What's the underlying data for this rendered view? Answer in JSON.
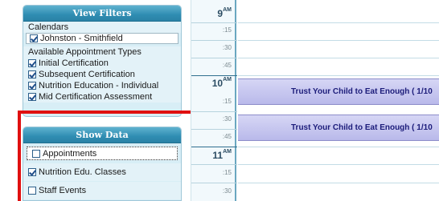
{
  "view_filters": {
    "title": "View Filters",
    "calendars_label": "Calendars",
    "calendars": [
      {
        "label": "Johnston - Smithfield",
        "checked": true
      }
    ],
    "appointment_types_label": "Available Appointment Types",
    "appointment_types": [
      {
        "label": "Initial Certification",
        "checked": true
      },
      {
        "label": "Subsequent Certification",
        "checked": true
      },
      {
        "label": "Nutrition Education - Individual",
        "checked": true
      },
      {
        "label": "Mid Certification Assessment",
        "checked": true
      }
    ]
  },
  "show_data": {
    "title": "Show Data",
    "items": [
      {
        "label": "Appointments",
        "checked": false
      },
      {
        "label": "Nutrition Edu. Classes",
        "checked": true
      },
      {
        "label": "Staff Events",
        "checked": false
      }
    ]
  },
  "time_column": {
    "hours": [
      {
        "hour": "9",
        "suffix": "AM"
      },
      {
        "hour": "10",
        "suffix": "AM"
      },
      {
        "hour": "11",
        "suffix": "AM"
      }
    ],
    "slots": [
      ":15",
      ":30",
      ":45"
    ]
  },
  "events": [
    {
      "title": "Trust Your Child to Eat Enough ( 1/10",
      "color": "#c8c8f0"
    },
    {
      "title": "Trust Your Child to Eat Enough ( 1/10",
      "color": "#c8c8f0"
    }
  ],
  "colors": {
    "panel_header": "#2f8db2",
    "panel_bg": "#d8eef6",
    "highlight_outline": "#e01010",
    "event_text": "#1c1c7a"
  }
}
